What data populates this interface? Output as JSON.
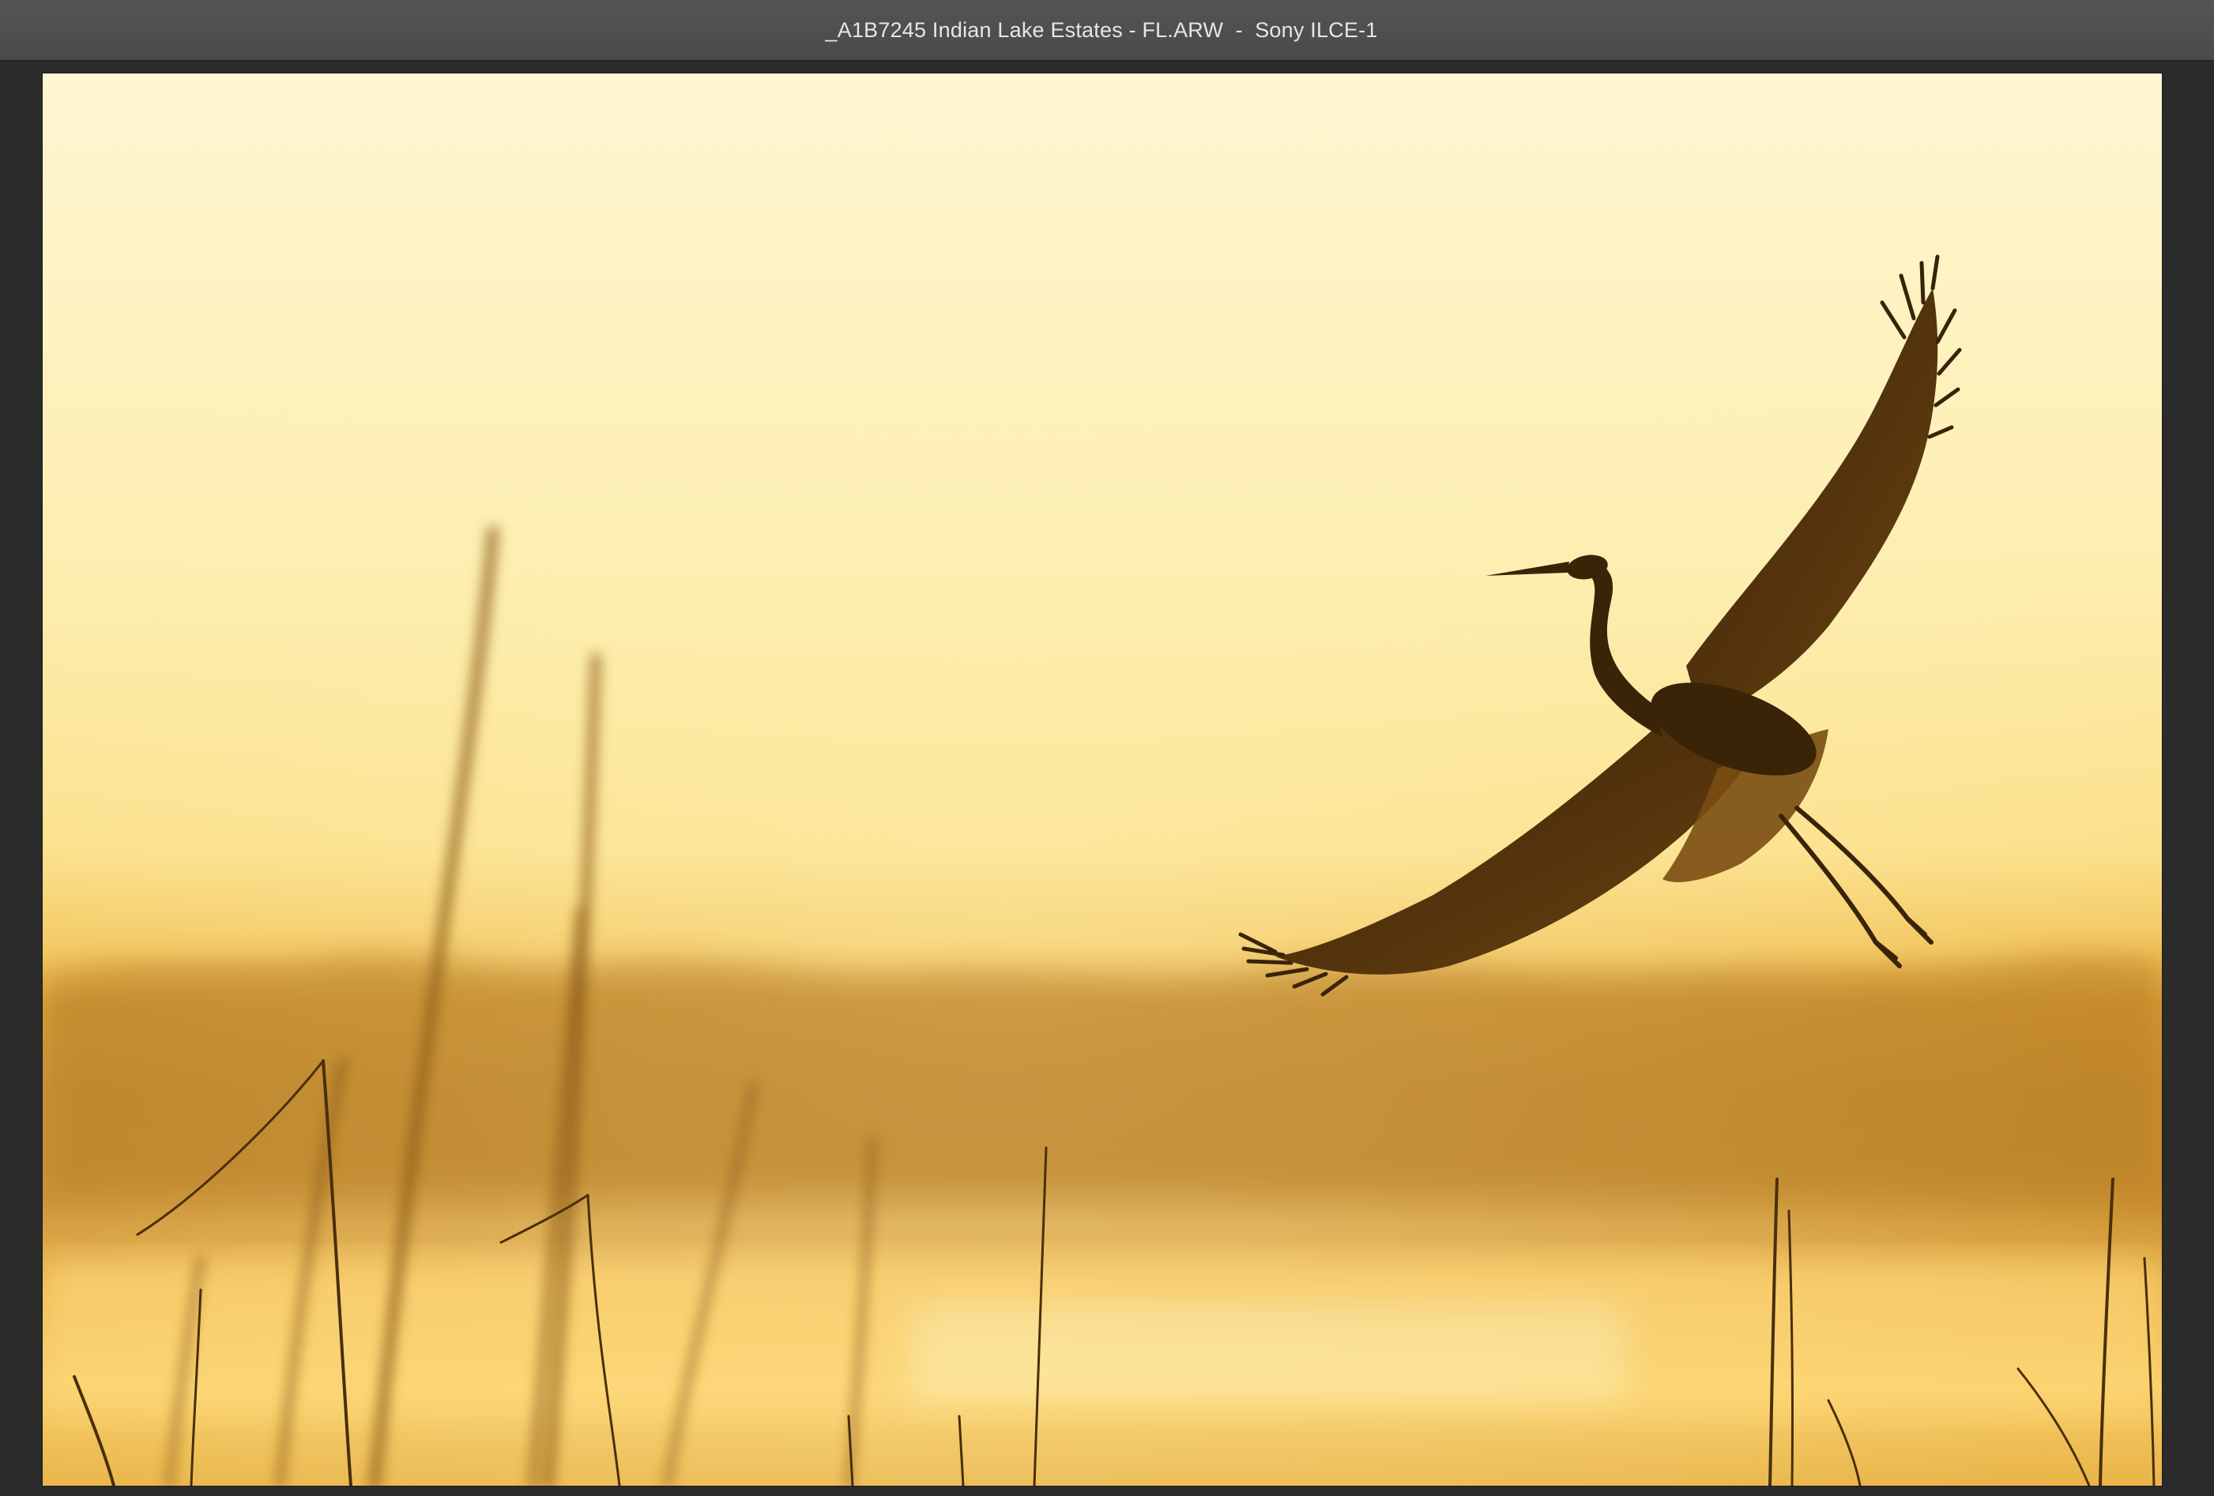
{
  "window": {
    "title": "_A1B7245 Indian Lake Estates - FL.ARW  -  Sony ILCE-1"
  },
  "photo": {
    "subject_icon": "egret-silhouette-icon",
    "colors": {
      "sky_top": "#fff6cf",
      "sky_mid": "#fde79a",
      "horizon": "#e7a93a",
      "treeline": "#c08a2a",
      "water": "#f4c25a",
      "silhouette": "#3a2408"
    }
  }
}
